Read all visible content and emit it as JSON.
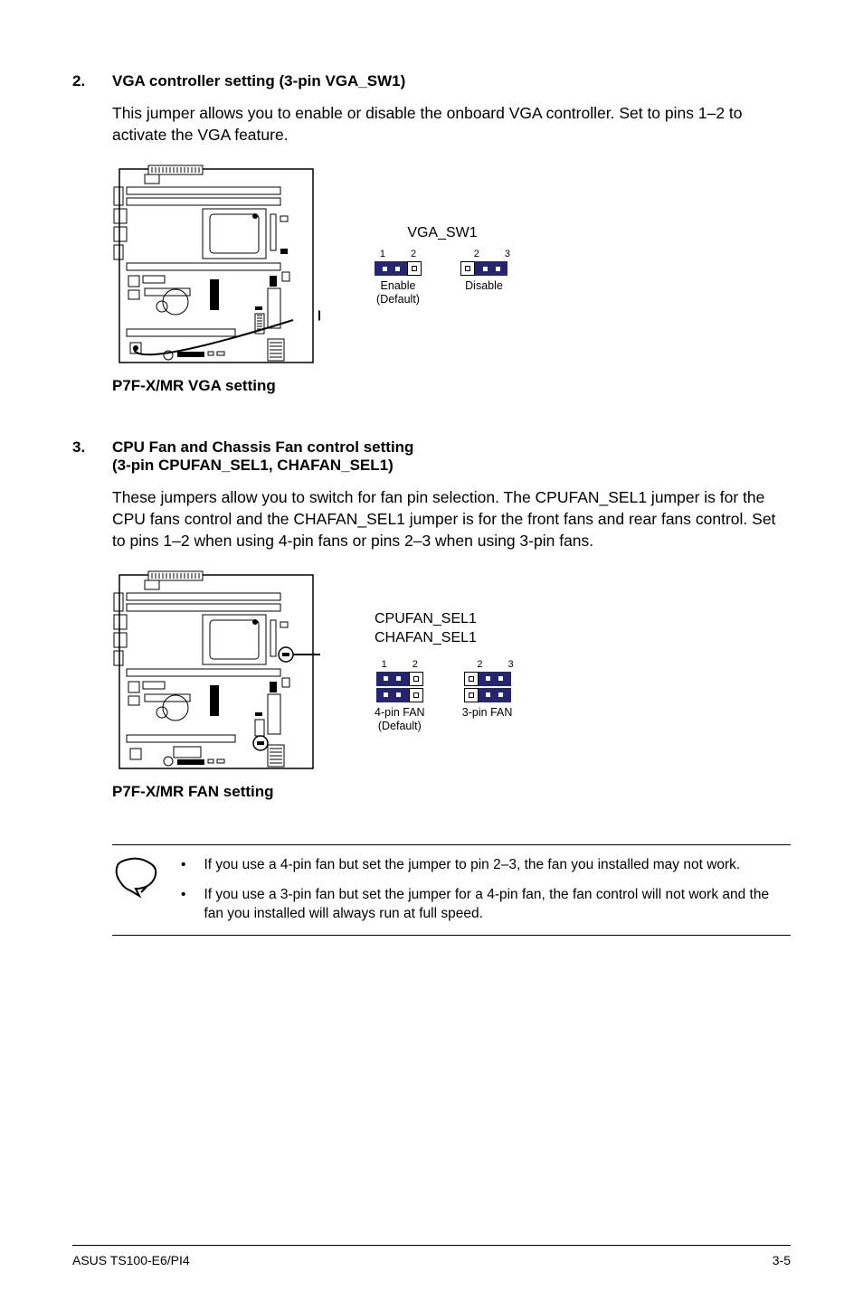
{
  "section2": {
    "num": "2.",
    "title": "VGA controller setting (3-pin VGA_SW1)",
    "body": "This jumper allows you to enable or disable the onboard VGA controller. Set to pins 1–2 to activate the VGA feature.",
    "jumper_title": "VGA_SW1",
    "pin1": "1",
    "pin2": "2",
    "pin2b": "2",
    "pin3": "3",
    "enable": "Enable",
    "default": "(Default)",
    "disable": "Disable",
    "caption": "P7F-X/MR VGA setting"
  },
  "section3": {
    "num": "3.",
    "title_line1": "CPU Fan and Chassis Fan control setting",
    "title_line2": "(3-pin CPUFAN_SEL1, CHAFAN_SEL1)",
    "body": "These jumpers allow you to switch for fan pin selection. The CPUFAN_SEL1 jumper is for the CPU fans control and the CHAFAN_SEL1 jumper is for the front fans and rear fans control. Set to pins 1–2 when using 4-pin fans or pins 2–3 when using 3-pin fans.",
    "jumper_title1": "CPUFAN_SEL1",
    "jumper_title2": "CHAFAN_SEL1",
    "pin1": "1",
    "pin2": "2",
    "pin2b": "2",
    "pin3": "3",
    "fourpin": "4-pin FAN",
    "default": "(Default)",
    "threepin": "3-pin FAN",
    "caption": "P7F-X/MR FAN setting"
  },
  "notes": {
    "item1": "If you use a 4-pin fan but set the jumper to pin 2–3, the fan you installed may not work.",
    "item2": "If you use a 3-pin fan but set the jumper for a 4-pin fan, the fan control will not work and the fan you installed will always run at full speed."
  },
  "footer": {
    "left": "ASUS TS100-E6/PI4",
    "right": "3-5"
  }
}
